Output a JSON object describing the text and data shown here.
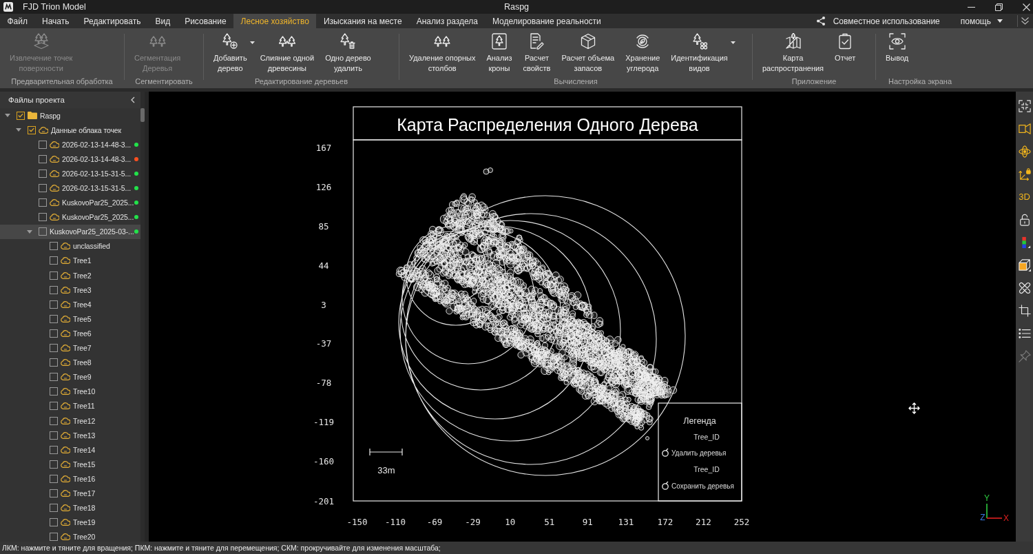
{
  "window": {
    "app_name": "FJD Trion Model",
    "title": "Raspg"
  },
  "menu": {
    "tabs": [
      {
        "label": "Файл",
        "selected": false
      },
      {
        "label": "Начать",
        "selected": false
      },
      {
        "label": "Редактировать",
        "selected": false
      },
      {
        "label": "Вид",
        "selected": false
      },
      {
        "label": "Рисование",
        "selected": false
      },
      {
        "label": "Лесное хозяйство",
        "selected": true
      },
      {
        "label": "Изыскания на месте",
        "selected": false
      },
      {
        "label": "Анализ раздела",
        "selected": false
      },
      {
        "label": "Моделирование реальности",
        "selected": false
      }
    ],
    "share": {
      "label": "Совместное использование"
    },
    "help": {
      "label": "помощь"
    }
  },
  "ribbon": {
    "groups": [
      {
        "label": "Предварительная обработка",
        "buttons": [
          {
            "label": "Извлечение точек\nповерхности",
            "disabled": true
          }
        ]
      },
      {
        "label": "Сегментировать",
        "buttons": [
          {
            "label": "Сегментация\nДеревья",
            "disabled": true
          }
        ]
      },
      {
        "label": "Редактирование деревьев",
        "buttons": [
          {
            "label": "Добавить\nдерево",
            "disabled": false,
            "dropdown": true
          },
          {
            "label": "Слияние одной\nдревесины",
            "disabled": false
          },
          {
            "label": "Одно дерево\nудалить",
            "disabled": false
          }
        ]
      },
      {
        "label": "Вычисления",
        "buttons": [
          {
            "label": "Удаление опорных\nстолбов",
            "disabled": false
          },
          {
            "label": "Анализ\nкроны",
            "disabled": false
          },
          {
            "label": "Расчет\nсвойств",
            "disabled": false
          },
          {
            "label": "Расчет объема\nзапасов",
            "disabled": false
          },
          {
            "label": "Хранение\nуглерода",
            "disabled": false
          },
          {
            "label": "Идентификация\nвидов",
            "disabled": false,
            "dropdown": true
          }
        ]
      },
      {
        "label": "Приложение",
        "buttons": [
          {
            "label": "Карта\nраспространения",
            "disabled": false
          },
          {
            "label": "Отчет",
            "disabled": false
          }
        ]
      },
      {
        "label": "Настройка экрана",
        "buttons": [
          {
            "label": "Вывод",
            "disabled": false
          }
        ]
      }
    ]
  },
  "project_panel": {
    "title": "Файлы проекта",
    "tree": [
      {
        "kind": "folder",
        "label": "Raspg",
        "checked": true,
        "expanded": true,
        "selected": false,
        "children": [
          {
            "kind": "cloud",
            "label": "Данные облака точек",
            "checked": true,
            "expanded": true,
            "selected": false,
            "children": [
              {
                "kind": "cloud",
                "label": "2026-02-13-14-48-3...",
                "checked": false,
                "selected": false,
                "color": "#22e34a"
              },
              {
                "kind": "cloud",
                "label": "2026-02-13-14-48-3...",
                "checked": false,
                "selected": false,
                "color": "#ff5020"
              },
              {
                "kind": "cloud",
                "label": "2026-02-13-15-31-5...",
                "checked": false,
                "selected": false,
                "color": "#22e34a"
              },
              {
                "kind": "cloud",
                "label": "2026-02-13-15-31-5...",
                "checked": false,
                "selected": false,
                "color": "#22e34a"
              },
              {
                "kind": "cloud",
                "label": "KuskovoPar25_2025...",
                "checked": false,
                "selected": false,
                "color": "#22e34a"
              },
              {
                "kind": "cloud",
                "label": "KuskovoPar25_2025...",
                "checked": false,
                "selected": false,
                "color": "#22e34a"
              },
              {
                "kind": "dataset",
                "label": "KuskovoPar25_2025-03-...",
                "checked": false,
                "expanded": true,
                "selected": true,
                "color": "#22e34a",
                "children": [
                  {
                    "kind": "cloud",
                    "label": "unclassified",
                    "checked": false,
                    "selected": false
                  },
                  {
                    "kind": "cloud",
                    "label": "Tree1",
                    "checked": false,
                    "selected": false
                  },
                  {
                    "kind": "cloud",
                    "label": "Tree2",
                    "checked": false,
                    "selected": false
                  },
                  {
                    "kind": "cloud",
                    "label": "Tree3",
                    "checked": false,
                    "selected": false
                  },
                  {
                    "kind": "cloud",
                    "label": "Tree4",
                    "checked": false,
                    "selected": false
                  },
                  {
                    "kind": "cloud",
                    "label": "Tree5",
                    "checked": false,
                    "selected": false
                  },
                  {
                    "kind": "cloud",
                    "label": "Tree6",
                    "checked": false,
                    "selected": false
                  },
                  {
                    "kind": "cloud",
                    "label": "Tree7",
                    "checked": false,
                    "selected": false
                  },
                  {
                    "kind": "cloud",
                    "label": "Tree8",
                    "checked": false,
                    "selected": false
                  },
                  {
                    "kind": "cloud",
                    "label": "Tree9",
                    "checked": false,
                    "selected": false
                  },
                  {
                    "kind": "cloud",
                    "label": "Tree10",
                    "checked": false,
                    "selected": false
                  },
                  {
                    "kind": "cloud",
                    "label": "Tree11",
                    "checked": false,
                    "selected": false
                  },
                  {
                    "kind": "cloud",
                    "label": "Tree12",
                    "checked": false,
                    "selected": false
                  },
                  {
                    "kind": "cloud",
                    "label": "Tree13",
                    "checked": false,
                    "selected": false
                  },
                  {
                    "kind": "cloud",
                    "label": "Tree14",
                    "checked": false,
                    "selected": false
                  },
                  {
                    "kind": "cloud",
                    "label": "Tree15",
                    "checked": false,
                    "selected": false
                  },
                  {
                    "kind": "cloud",
                    "label": "Tree16",
                    "checked": false,
                    "selected": false
                  },
                  {
                    "kind": "cloud",
                    "label": "Tree17",
                    "checked": false,
                    "selected": false
                  },
                  {
                    "kind": "cloud",
                    "label": "Tree18",
                    "checked": false,
                    "selected": false
                  },
                  {
                    "kind": "cloud",
                    "label": "Tree19",
                    "checked": false,
                    "selected": false
                  },
                  {
                    "kind": "cloud",
                    "label": "Tree20",
                    "checked": false,
                    "selected": false
                  }
                ]
              }
            ]
          }
        ]
      }
    ]
  },
  "viewport": {
    "map": {
      "chart_data": {
        "type": "scatter",
        "title": "Карта Распределения Одного Дерева",
        "xlim": [
          -154,
          252
        ],
        "ylim": [
          -201,
          175
        ],
        "xticks": [
          -150,
          -110,
          -69,
          -29,
          10,
          51,
          91,
          131,
          172,
          212,
          252
        ],
        "yticks": [
          167,
          126,
          85,
          44,
          3,
          -37,
          -78,
          -119,
          -160,
          -201
        ]
      },
      "legend": {
        "title": "Легенда",
        "entries": [
          {
            "heading": "Tree_ID",
            "label": "Удалить деревья"
          },
          {
            "heading": "Tree_ID",
            "label": "Сохранить деревья"
          }
        ]
      },
      "scale_bar": {
        "label": "33m"
      }
    },
    "toolbar": [
      {
        "kind": "icon",
        "active": false,
        "disabled": false
      },
      {
        "kind": "icon",
        "active": true,
        "disabled": false
      },
      {
        "kind": "icon",
        "active": true,
        "disabled": false
      },
      {
        "kind": "icon",
        "active": true,
        "disabled": false
      },
      {
        "kind": "text",
        "label": "3D",
        "active": true,
        "disabled": false
      },
      {
        "kind": "icon",
        "active": false,
        "disabled": false
      },
      {
        "kind": "icon",
        "active": false,
        "disabled": false
      },
      {
        "kind": "icon",
        "active": false,
        "disabled": false
      },
      {
        "kind": "icon",
        "active": false,
        "disabled": false
      },
      {
        "kind": "icon",
        "active": false,
        "disabled": false
      },
      {
        "kind": "icon",
        "active": false,
        "disabled": false
      },
      {
        "kind": "icon",
        "active": false,
        "disabled": true
      }
    ],
    "axis_gizmo": {
      "y_label": "Y",
      "z_label": "Z",
      "x_label": "X"
    }
  },
  "status_bar": {
    "text": "ЛКМ: нажмите и тяните для вращения; ПКМ: нажмите и тяните для перемещения; СКМ: прокручивайте для изменения масштаба;"
  }
}
